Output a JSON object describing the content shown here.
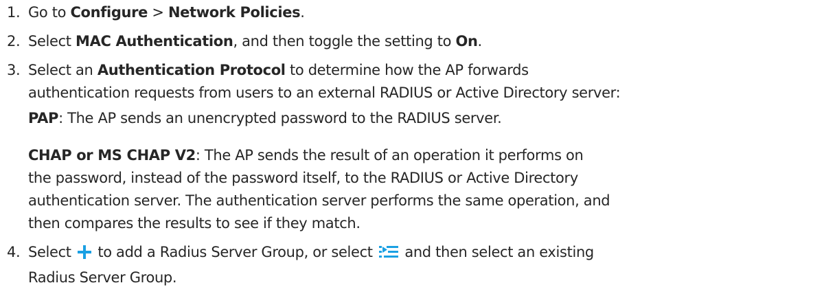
{
  "steps": [
    {
      "number": "1.",
      "before": "Go to ",
      "bold1": "Configure",
      "sep": " > ",
      "bold2": "Network Policies",
      "after": "."
    },
    {
      "number": "2.",
      "before": "Select ",
      "bold1": "MAC Authentication",
      "middle": ", and then toggle the setting to ",
      "bold2": "On",
      "after": "."
    },
    {
      "number": "3.",
      "before": "Select an ",
      "bold1": "Authentication Protocol",
      "middle_line1": " to determine how the AP forwards",
      "line2": "authentication requests from users to an external RADIUS or Active Directory server:",
      "pap_label": "PAP",
      "pap_text": ": The AP sends an unencrypted password to the RADIUS server.",
      "chap_label": "CHAP or MS CHAP V2",
      "chap_text1": ": The AP sends the result of an operation it performs on",
      "chap_text2": "the password, instead of the password itself, to the RADIUS or Active Directory",
      "chap_text3": "authentication server. The authentication server performs the same operation, and",
      "chap_text4": "then compares the results to see if they match."
    },
    {
      "number": "4.",
      "before": "Select ",
      "icon_add": "plus-icon",
      "middle": " to add a Radius Server Group, or select ",
      "icon_list": "list-select-icon",
      "after_line1": " and then select an existing",
      "line2": "Radius Server Group."
    }
  ],
  "colors": {
    "text": "#262626",
    "icon_accent": "#1aa0e3"
  }
}
